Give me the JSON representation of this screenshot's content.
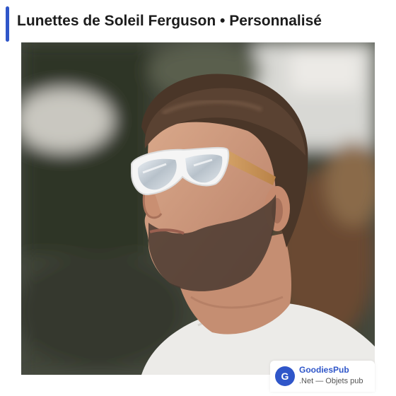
{
  "header": {
    "title": "Lunettes de Soleil Ferguson • Personnalisé",
    "accent_color": "#2f56c9"
  },
  "product_image": {
    "subject": "man-wearing-white-sunglasses-with-bamboo-temples"
  },
  "brand": {
    "logo_letter": "G",
    "name": "GoodiesPub",
    "tagline": ".Net — Objets pub"
  }
}
